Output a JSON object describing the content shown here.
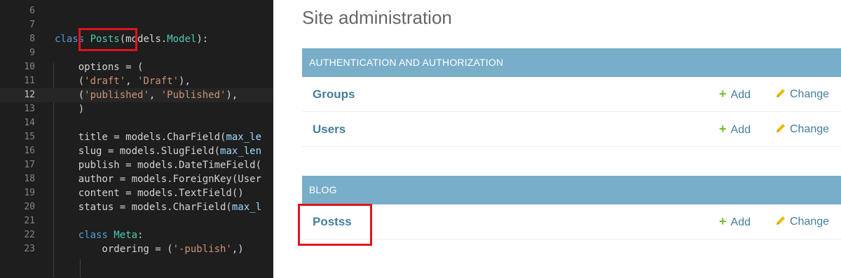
{
  "editor": {
    "lines": [
      {
        "n": "6",
        "parts": []
      },
      {
        "n": "7",
        "parts": []
      },
      {
        "n": "8",
        "parts": [
          [
            "kw",
            "class "
          ],
          [
            "cls",
            "Posts"
          ],
          [
            "",
            "("
          ],
          [
            "",
            "models."
          ],
          [
            "cls",
            "Model"
          ],
          [
            "",
            "):"
          ]
        ]
      },
      {
        "n": "9",
        "parts": []
      },
      {
        "n": "10",
        "parts": [
          [
            "",
            "    options = ("
          ]
        ]
      },
      {
        "n": "11",
        "parts": [
          [
            "",
            "    ("
          ],
          [
            "str",
            "'draft'"
          ],
          [
            "",
            ", "
          ],
          [
            "str",
            "'Draft'"
          ],
          [
            "",
            "),"
          ]
        ]
      },
      {
        "n": "12",
        "parts": [
          [
            "",
            "    ("
          ],
          [
            "str",
            "'published'"
          ],
          [
            "",
            ", "
          ],
          [
            "str",
            "'Published'"
          ],
          [
            "",
            "),"
          ]
        ]
      },
      {
        "n": "13",
        "parts": [
          [
            "",
            "    )"
          ]
        ]
      },
      {
        "n": "14",
        "parts": []
      },
      {
        "n": "15",
        "parts": [
          [
            "",
            "    title = models.CharField("
          ],
          [
            "prm",
            "max_le"
          ]
        ]
      },
      {
        "n": "16",
        "parts": [
          [
            "",
            "    slug = models.SlugField("
          ],
          [
            "prm",
            "max_len"
          ]
        ]
      },
      {
        "n": "17",
        "parts": [
          [
            "",
            "    publish = models.DateTimeField("
          ]
        ]
      },
      {
        "n": "18",
        "parts": [
          [
            "",
            "    author = models.ForeignKey(User"
          ]
        ]
      },
      {
        "n": "19",
        "parts": [
          [
            "",
            "    content = models.TextField()"
          ]
        ]
      },
      {
        "n": "20",
        "parts": [
          [
            "",
            "    status = models.CharField("
          ],
          [
            "prm",
            "max_l"
          ]
        ]
      },
      {
        "n": "21",
        "parts": []
      },
      {
        "n": "22",
        "parts": [
          [
            "",
            "    "
          ],
          [
            "kw",
            "class "
          ],
          [
            "cls",
            "Meta"
          ],
          [
            "",
            ":"
          ]
        ]
      },
      {
        "n": "23",
        "parts": [
          [
            "",
            "        ordering = ("
          ],
          [
            "str",
            "'-publish'"
          ],
          [
            "",
            ",)"
          ]
        ]
      }
    ],
    "current_line": "12"
  },
  "admin": {
    "site_title": "Site administration",
    "add_label": "Add",
    "change_label": "Change",
    "modules": [
      {
        "caption": "AUTHENTICATION AND AUTHORIZATION",
        "models": [
          "Groups",
          "Users"
        ]
      },
      {
        "caption": "BLOG",
        "models": [
          "Postss"
        ]
      }
    ]
  },
  "colors": {
    "highlight_border": "#e0141e",
    "caption_bg": "#79aec8",
    "link": "#447e9b",
    "add_icon": "#70bf2b",
    "change_icon": "#efb80b"
  }
}
